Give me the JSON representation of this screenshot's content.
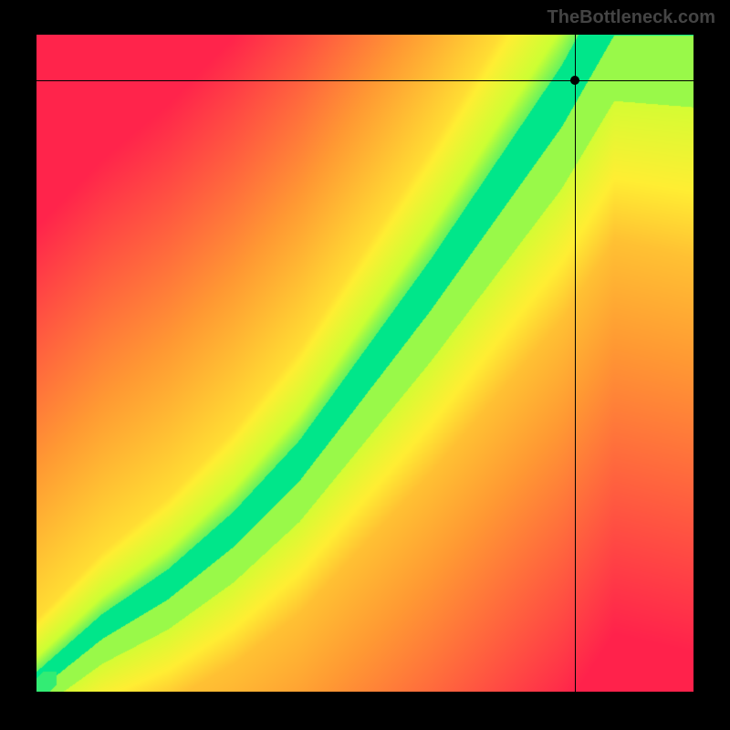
{
  "watermark": "TheBottleneck.com",
  "chart_data": {
    "type": "heatmap",
    "title": "",
    "xlabel": "",
    "ylabel": "",
    "xlim": [
      0,
      100
    ],
    "ylim": [
      0,
      100
    ],
    "color_scale": {
      "low": "#ff1a4d",
      "mid_low": "#ff9933",
      "mid": "#ffee33",
      "mid_high": "#ccff33",
      "high": "#00e68a"
    },
    "optimal_curve": [
      {
        "x": 0,
        "y": 0
      },
      {
        "x": 10,
        "y": 8
      },
      {
        "x": 20,
        "y": 14
      },
      {
        "x": 30,
        "y": 22
      },
      {
        "x": 40,
        "y": 32
      },
      {
        "x": 50,
        "y": 45
      },
      {
        "x": 60,
        "y": 58
      },
      {
        "x": 70,
        "y": 72
      },
      {
        "x": 80,
        "y": 86
      },
      {
        "x": 88,
        "y": 100
      }
    ],
    "marker": {
      "x": 82,
      "y": 93
    },
    "crosshair": {
      "x": 82,
      "y": 93
    }
  }
}
